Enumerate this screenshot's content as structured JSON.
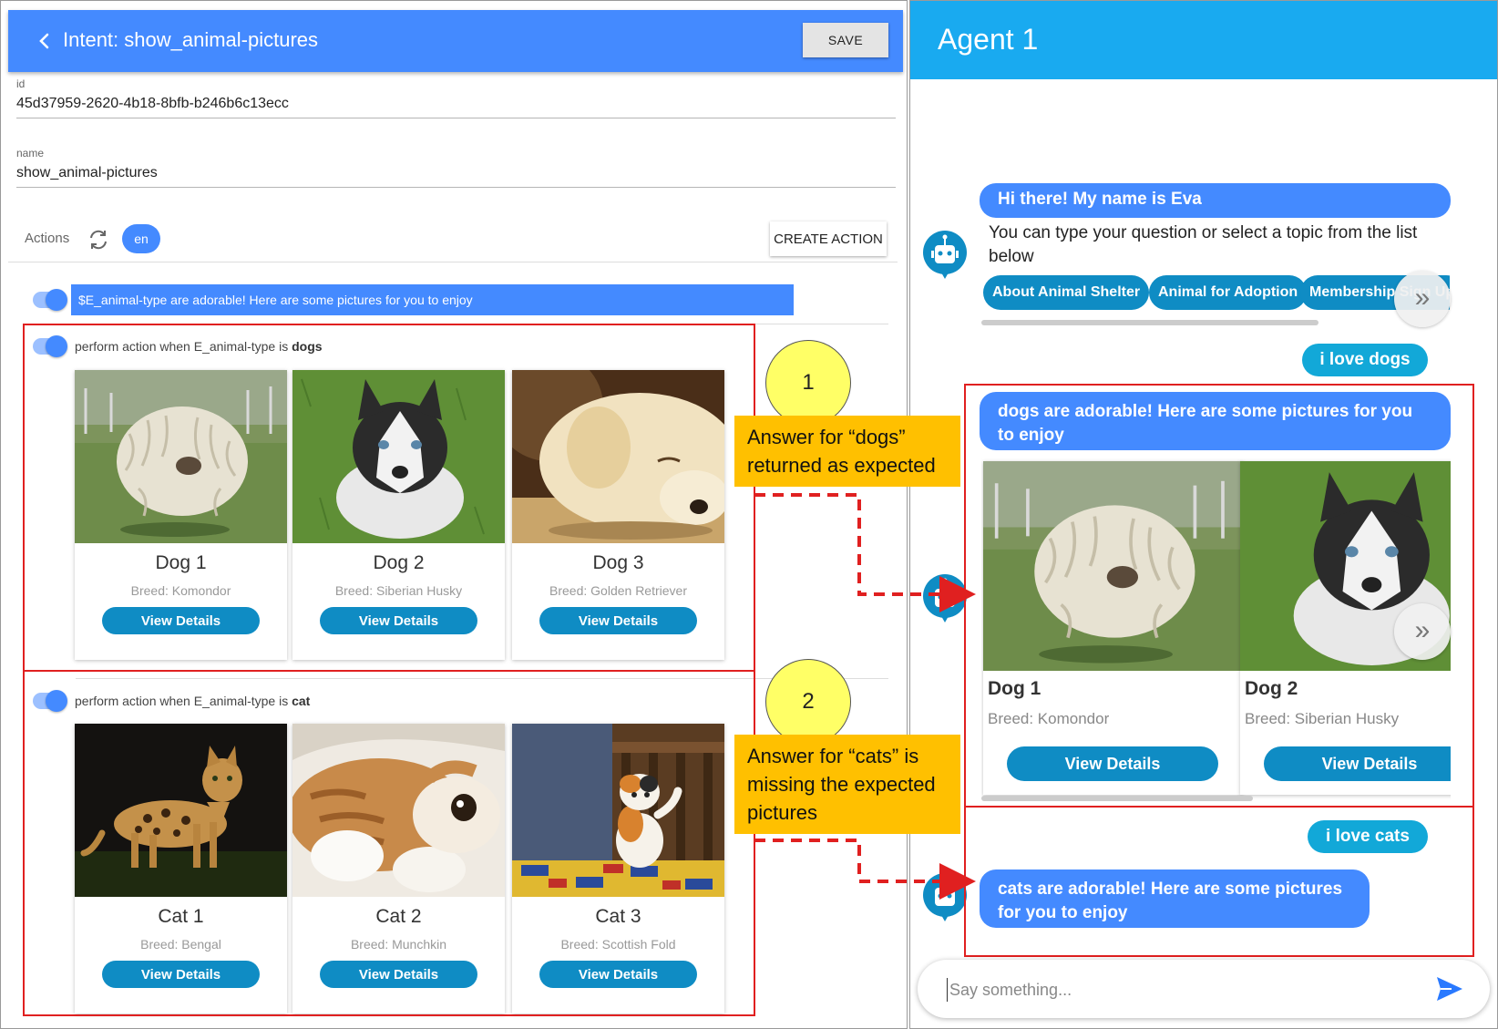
{
  "editor": {
    "title": "Intent: show_animal-pictures",
    "save_label": "SAVE",
    "id_label": "id",
    "id_value": "45d37959-2620-4b18-8bfb-b246b6c13ecc",
    "name_label": "name",
    "name_value": "show_animal-pictures",
    "actions_label": "Actions",
    "lang_chip": "en",
    "create_action_label": "CREATE ACTION",
    "response_text": "$E_animal-type are adorable! Here are some pictures for you to enjoy",
    "conditions": [
      {
        "prefix": "perform action when E_animal-type is ",
        "value": "dogs",
        "cards": [
          {
            "title": "Dog 1",
            "breed": "Breed: Komondor",
            "button": "View Details"
          },
          {
            "title": "Dog 2",
            "breed": "Breed: Siberian Husky",
            "button": "View Details"
          },
          {
            "title": "Dog 3",
            "breed": "Breed: Golden Retriever",
            "button": "View Details"
          }
        ]
      },
      {
        "prefix": "perform action when E_animal-type is ",
        "value": "cat",
        "cards": [
          {
            "title": "Cat 1",
            "breed": "Breed: Bengal",
            "button": "View Details"
          },
          {
            "title": "Cat 2",
            "breed": "Breed: Munchkin",
            "button": "View Details"
          },
          {
            "title": "Cat 3",
            "breed": "Breed: Scottish Fold",
            "button": "View Details"
          }
        ]
      }
    ]
  },
  "annotations": [
    {
      "number": "1",
      "line1": "Answer for “dogs”",
      "line2": "returned as expected",
      "line3": ""
    },
    {
      "number": "2",
      "line1": "Answer for “cats” is",
      "line2": "missing the expected",
      "line3": "pictures"
    }
  ],
  "chat": {
    "title": "Agent 1",
    "greeting": "Hi there! My name is Eva",
    "intro": "You can type your question or select a topic from the list below",
    "topics": [
      "About Animal Shelter",
      "Animal for Adoption",
      "Membership Sign Up"
    ],
    "next_glyph": "»",
    "user_message_1": "i love dogs",
    "bot_reply_1": "dogs are adorable! Here are some pictures for you to enjoy",
    "carousel": [
      {
        "title": "Dog 1",
        "breed": "Breed: Komondor",
        "button": "View Details"
      },
      {
        "title": "Dog 2",
        "breed": "Breed: Siberian Husky",
        "button": "View Details"
      }
    ],
    "user_message_2": "i love cats",
    "bot_reply_2": "cats are adorable! Here are some pictures for you to enjoy",
    "input_placeholder": "Say something..."
  },
  "colors": {
    "header_blue": "#448aff",
    "chat_header": "#19aaf0",
    "button_teal": "#0f8cc4",
    "annotation_yellow": "#ffc000",
    "annotation_circle": "#ffff66",
    "highlight_red": "#e02020"
  }
}
